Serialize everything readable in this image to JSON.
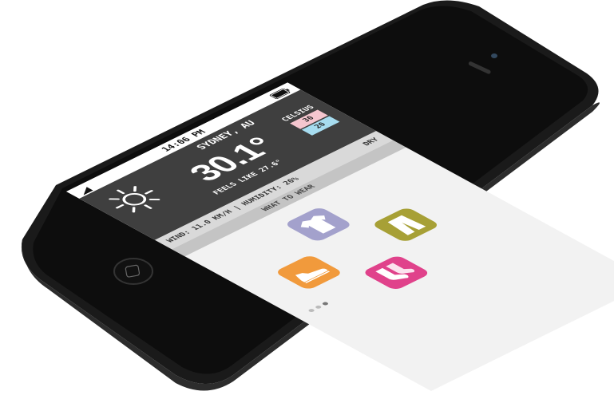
{
  "status_bar": {
    "time": "14:06 PM"
  },
  "weather": {
    "city": "SYDNEY, AU",
    "temperature": "30.1°",
    "unit_label": "CELSIUS",
    "high": "30",
    "low": "20",
    "feels_like": "FEELS LIKE 27.6°",
    "wind": "WIND: 11.0 KM/H | HUMIDITY: 20%",
    "condition": "DRY"
  },
  "wear": {
    "title": "WHAT TO WEAR",
    "items": [
      {
        "icon": "shirt-icon",
        "color": "#a3a1cc"
      },
      {
        "icon": "pants-icon",
        "color": "#a7a036"
      },
      {
        "icon": "shoes-icon",
        "color": "#f19a3c"
      },
      {
        "icon": "socks-icon",
        "color": "#e0428b"
      }
    ]
  },
  "pager": {
    "dots": 3,
    "active": 2
  },
  "colors": {
    "header_bg": "#3f3f3f",
    "strip_bg": "#d9d9d9"
  }
}
